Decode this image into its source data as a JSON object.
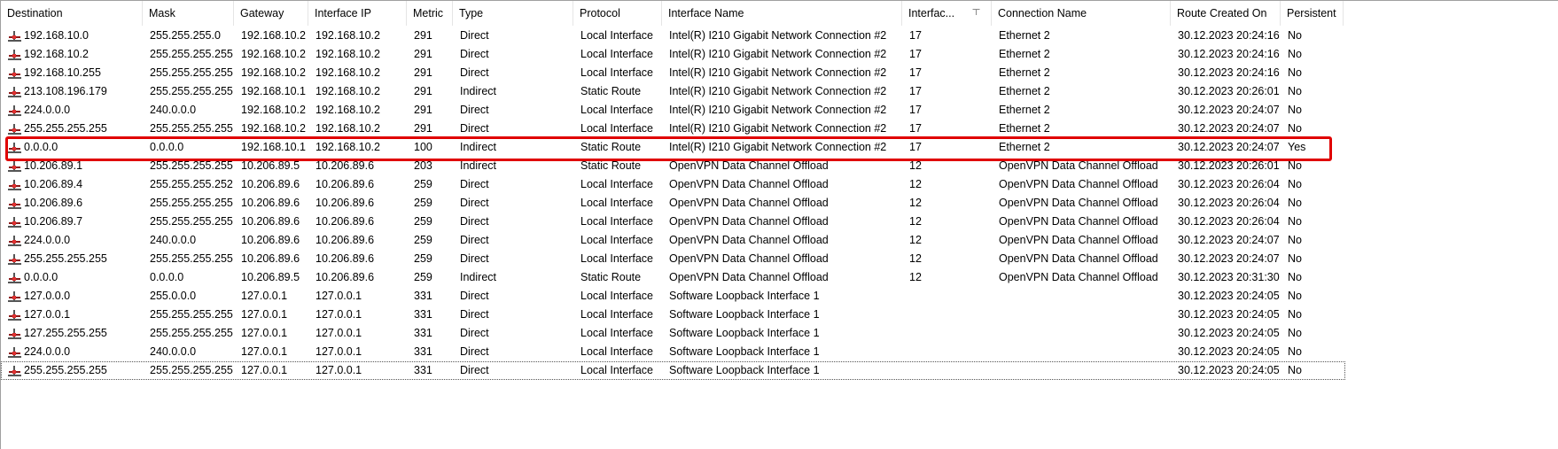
{
  "columns": [
    "Destination",
    "Mask",
    "Gateway",
    "Interface IP",
    "Metric",
    "Type",
    "Protocol",
    "Interface Name",
    "Interfac...",
    "Connection Name",
    "Route Created On",
    "Persistent"
  ],
  "highlight_color": "#e00000",
  "sorted_column": "Interfac...",
  "rows": [
    [
      "192.168.10.0",
      "255.255.255.0",
      "192.168.10.2",
      "192.168.10.2",
      "291",
      "Direct",
      "Local Interface",
      "Intel(R) I210 Gigabit Network Connection #2",
      "17",
      "Ethernet 2",
      "30.12.2023 20:24:16",
      "No"
    ],
    [
      "192.168.10.2",
      "255.255.255.255",
      "192.168.10.2",
      "192.168.10.2",
      "291",
      "Direct",
      "Local Interface",
      "Intel(R) I210 Gigabit Network Connection #2",
      "17",
      "Ethernet 2",
      "30.12.2023 20:24:16",
      "No"
    ],
    [
      "192.168.10.255",
      "255.255.255.255",
      "192.168.10.2",
      "192.168.10.2",
      "291",
      "Direct",
      "Local Interface",
      "Intel(R) I210 Gigabit Network Connection #2",
      "17",
      "Ethernet 2",
      "30.12.2023 20:24:16",
      "No"
    ],
    [
      "213.108.196.179",
      "255.255.255.255",
      "192.168.10.1",
      "192.168.10.2",
      "291",
      "Indirect",
      "Static Route",
      "Intel(R) I210 Gigabit Network Connection #2",
      "17",
      "Ethernet 2",
      "30.12.2023 20:26:01",
      "No"
    ],
    [
      "224.0.0.0",
      "240.0.0.0",
      "192.168.10.2",
      "192.168.10.2",
      "291",
      "Direct",
      "Local Interface",
      "Intel(R) I210 Gigabit Network Connection #2",
      "17",
      "Ethernet 2",
      "30.12.2023 20:24:07",
      "No"
    ],
    [
      "255.255.255.255",
      "255.255.255.255",
      "192.168.10.2",
      "192.168.10.2",
      "291",
      "Direct",
      "Local Interface",
      "Intel(R) I210 Gigabit Network Connection #2",
      "17",
      "Ethernet 2",
      "30.12.2023 20:24:07",
      "No"
    ],
    [
      "0.0.0.0",
      "0.0.0.0",
      "192.168.10.1",
      "192.168.10.2",
      "100",
      "Indirect",
      "Static Route",
      "Intel(R) I210 Gigabit Network Connection #2",
      "17",
      "Ethernet 2",
      "30.12.2023 20:24:07",
      "Yes"
    ],
    [
      "10.206.89.1",
      "255.255.255.255",
      "10.206.89.5",
      "10.206.89.6",
      "203",
      "Indirect",
      "Static Route",
      "OpenVPN Data Channel Offload",
      "12",
      "OpenVPN Data Channel Offload",
      "30.12.2023 20:26:01",
      "No"
    ],
    [
      "10.206.89.4",
      "255.255.255.252",
      "10.206.89.6",
      "10.206.89.6",
      "259",
      "Direct",
      "Local Interface",
      "OpenVPN Data Channel Offload",
      "12",
      "OpenVPN Data Channel Offload",
      "30.12.2023 20:26:04",
      "No"
    ],
    [
      "10.206.89.6",
      "255.255.255.255",
      "10.206.89.6",
      "10.206.89.6",
      "259",
      "Direct",
      "Local Interface",
      "OpenVPN Data Channel Offload",
      "12",
      "OpenVPN Data Channel Offload",
      "30.12.2023 20:26:04",
      "No"
    ],
    [
      "10.206.89.7",
      "255.255.255.255",
      "10.206.89.6",
      "10.206.89.6",
      "259",
      "Direct",
      "Local Interface",
      "OpenVPN Data Channel Offload",
      "12",
      "OpenVPN Data Channel Offload",
      "30.12.2023 20:26:04",
      "No"
    ],
    [
      "224.0.0.0",
      "240.0.0.0",
      "10.206.89.6",
      "10.206.89.6",
      "259",
      "Direct",
      "Local Interface",
      "OpenVPN Data Channel Offload",
      "12",
      "OpenVPN Data Channel Offload",
      "30.12.2023 20:24:07",
      "No"
    ],
    [
      "255.255.255.255",
      "255.255.255.255",
      "10.206.89.6",
      "10.206.89.6",
      "259",
      "Direct",
      "Local Interface",
      "OpenVPN Data Channel Offload",
      "12",
      "OpenVPN Data Channel Offload",
      "30.12.2023 20:24:07",
      "No"
    ],
    [
      "0.0.0.0",
      "0.0.0.0",
      "10.206.89.5",
      "10.206.89.6",
      "259",
      "Indirect",
      "Static Route",
      "OpenVPN Data Channel Offload",
      "12",
      "OpenVPN Data Channel Offload",
      "30.12.2023 20:31:30",
      "No"
    ],
    [
      "127.0.0.0",
      "255.0.0.0",
      "127.0.0.1",
      "127.0.0.1",
      "331",
      "Direct",
      "Local Interface",
      "Software Loopback Interface 1",
      "",
      "",
      "30.12.2023 20:24:05",
      "No"
    ],
    [
      "127.0.0.1",
      "255.255.255.255",
      "127.0.0.1",
      "127.0.0.1",
      "331",
      "Direct",
      "Local Interface",
      "Software Loopback Interface 1",
      "",
      "",
      "30.12.2023 20:24:05",
      "No"
    ],
    [
      "127.255.255.255",
      "255.255.255.255",
      "127.0.0.1",
      "127.0.0.1",
      "331",
      "Direct",
      "Local Interface",
      "Software Loopback Interface 1",
      "",
      "",
      "30.12.2023 20:24:05",
      "No"
    ],
    [
      "224.0.0.0",
      "240.0.0.0",
      "127.0.0.1",
      "127.0.0.1",
      "331",
      "Direct",
      "Local Interface",
      "Software Loopback Interface 1",
      "",
      "",
      "30.12.2023 20:24:05",
      "No"
    ],
    [
      "255.255.255.255",
      "255.255.255.255",
      "127.0.0.1",
      "127.0.0.1",
      "331",
      "Direct",
      "Local Interface",
      "Software Loopback Interface 1",
      "",
      "",
      "30.12.2023 20:24:05",
      "No"
    ]
  ]
}
